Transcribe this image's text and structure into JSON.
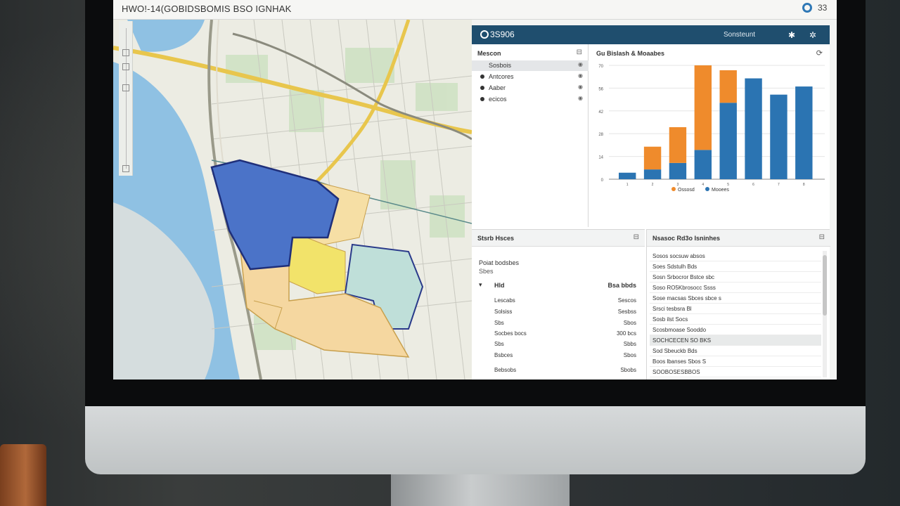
{
  "window": {
    "title": "HWO!-14(GOBIDSBOMIS BSO IGNHAK",
    "right_label": "33",
    "gear_icon": "gear-icon"
  },
  "dashboard": {
    "header": {
      "title": "3S906",
      "user": "Sonsteunt",
      "icons": [
        "expand-icon",
        "settings-icon"
      ]
    },
    "layers": {
      "title": "Mescon",
      "items": [
        {
          "label": "Sosbois",
          "selected": true
        },
        {
          "label": "Antcores",
          "selected": false
        },
        {
          "label": "Aaber",
          "selected": false
        },
        {
          "label": "ecicos",
          "selected": false
        }
      ]
    },
    "chart_panel": {
      "title": "Gu Bislash & Moaabes"
    },
    "stats": {
      "title": "Stsrb Hsces",
      "subtitle": "Poiat bodsbes",
      "subtitle2": "Sbes",
      "col_left": "Hld",
      "col_right": "Bsa bbds",
      "rows": [
        {
          "name": "Lescabs",
          "value": "Sescos"
        },
        {
          "name": "Solsiss",
          "value": "Sesbss"
        },
        {
          "name": "Sbs",
          "value": "Sbos"
        },
        {
          "name": "Socbes bocs",
          "value": "300 bcs"
        },
        {
          "name": "Sbs",
          "value": "Sbbs"
        },
        {
          "name": "Bsbces",
          "value": "Sbos"
        },
        {
          "name": "Bebsobs",
          "value": "Sbobs"
        }
      ]
    },
    "notes": {
      "title": "Nsasoc Rd3o Isninhes",
      "rows": [
        "Sosos socsuw absos",
        "Soes Sdstulh Bds",
        "Sosn Srbocror Bstce sbc",
        "Soso RO5Kbrosocc Ssss",
        "Sose macsas Sbces sbce s",
        "Srsci tesbsra Bl",
        "Sosb ilst Socs",
        "Scosbmoase Sooddo",
        "SOCHCECEN SO BKS",
        "Sod Sbeuckb Bds",
        "Boos lbanses Sbos S",
        "SOOBOSESBBOS"
      ],
      "highlight_index": 8
    }
  },
  "chart_data": {
    "type": "bar",
    "title": "Gu Bislash & Moaabes",
    "categories": [
      "1",
      "2",
      "3",
      "4",
      "5",
      "6",
      "7",
      "8"
    ],
    "series": [
      {
        "name": "Ossosd",
        "color": "#ef8b2c",
        "values": [
          0,
          14,
          22,
          52,
          20,
          0,
          0,
          0
        ]
      },
      {
        "name": "Mooees",
        "color": "#2b74b2",
        "values": [
          4,
          6,
          10,
          18,
          47,
          62,
          52,
          57
        ]
      }
    ],
    "ylim": [
      0,
      70
    ],
    "ytick_count": 6,
    "legend": "bottom",
    "grid": true
  }
}
